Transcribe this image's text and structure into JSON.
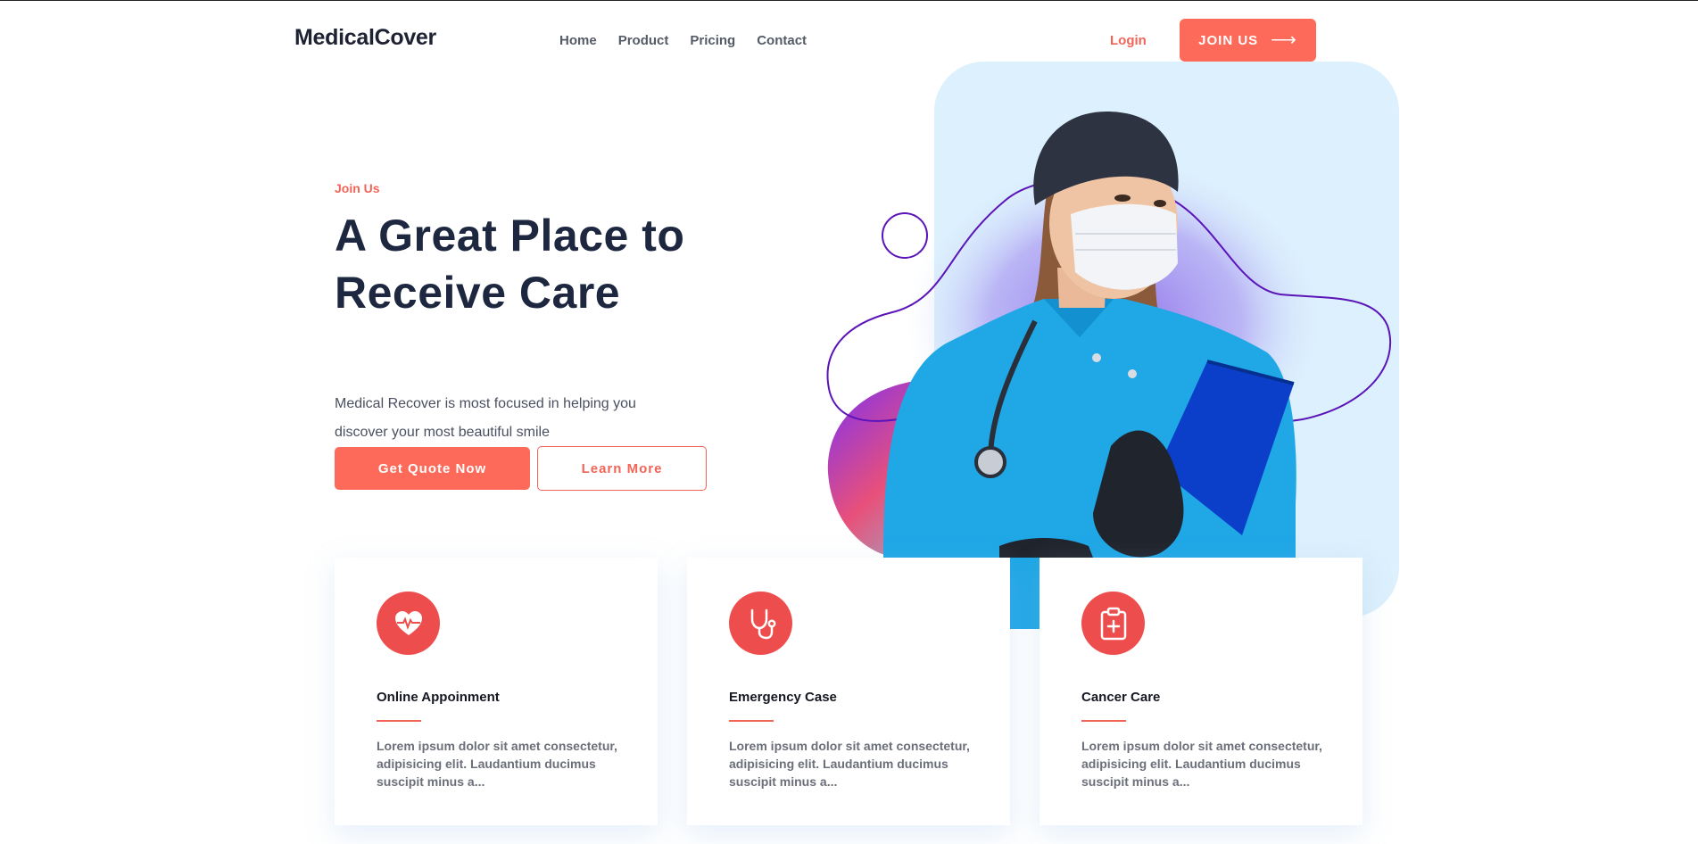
{
  "brand": {
    "logo": "MedicalCover"
  },
  "nav": {
    "items": [
      {
        "label": "Home"
      },
      {
        "label": "Product"
      },
      {
        "label": "Pricing"
      },
      {
        "label": "Contact"
      }
    ],
    "login_label": "Login",
    "join_label": "JOIN US",
    "join_icon": "arrow-right-icon"
  },
  "hero": {
    "eyebrow": "Join Us",
    "title": "A Great Place to Receive Care",
    "description": "Medical Recover is most focused in helping you discover your most beautiful smile",
    "primary_cta": "Get Quote Now",
    "secondary_cta": "Learn More",
    "image_alt": "nurse-with-mask-and-clipboard"
  },
  "features": [
    {
      "icon": "heart-pulse-icon",
      "title": "Online Appoinment",
      "text": "Lorem ipsum dolor sit amet consectetur, adipisicing elit. Laudantium ducimus suscipit minus a..."
    },
    {
      "icon": "stethoscope-icon",
      "title": "Emergency Case",
      "text": "Lorem ipsum dolor sit amet consectetur, adipisicing elit. Laudantium ducimus suscipit minus a..."
    },
    {
      "icon": "clipboard-plus-icon",
      "title": "Cancer Care",
      "text": "Lorem ipsum dolor sit amet consectetur, adipisicing elit. Laudantium ducimus suscipit minus a..."
    }
  ],
  "colors": {
    "accent": "#fd6a5a",
    "icon_bg": "#ee4d4d",
    "heading": "#1e2740",
    "panel_bg": "#dcf0fd",
    "line_purple": "#5b14b8"
  }
}
